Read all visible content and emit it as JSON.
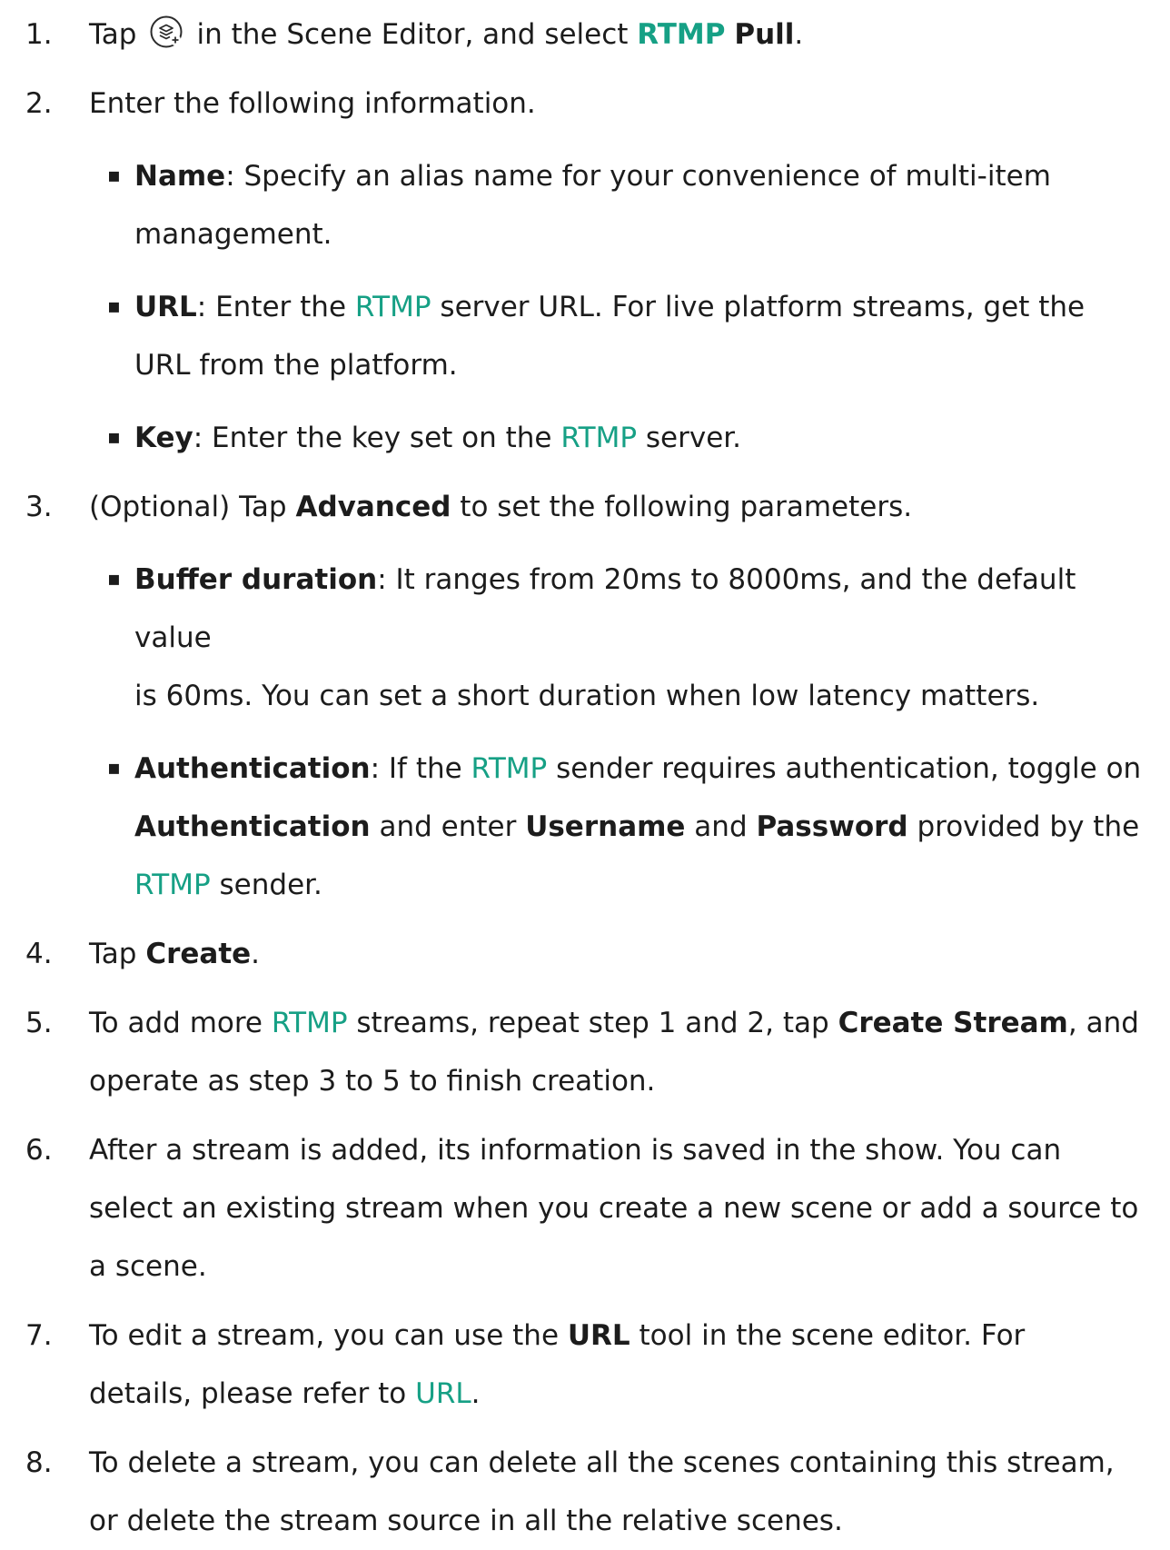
{
  "steps": [
    {
      "num": "1.",
      "parts": {
        "a": "Tap",
        "b": "in the Scene Editor, and select",
        "c": "RTMP",
        "d": "Pull",
        "e": "."
      },
      "icon": "layers-add-icon"
    },
    {
      "num": "2.",
      "text": "Enter the following information.",
      "bullets": [
        {
          "term": "Name",
          "rest": ": Specify an alias name for your convenience of multi-item",
          "cont": "management."
        },
        {
          "term": "URL",
          "pre": ": Enter the ",
          "link": "RTMP",
          "rest": " server URL. For live platform streams, get the",
          "cont": "URL from the platform."
        },
        {
          "term": "Key",
          "pre": ": Enter the key set on the ",
          "link": "RTMP",
          "rest": " server."
        }
      ]
    },
    {
      "num": "3.",
      "pre": "(Optional) Tap ",
      "bold": "Advanced",
      "rest": " to set the following parameters.",
      "bullets": [
        {
          "term": "Buffer duration",
          "rest": ": It ranges from 20ms to 8000ms, and the default value",
          "cont": "is 60ms. You can set a short duration when low latency matters."
        },
        {
          "term": "Authentication",
          "pre": ": If the ",
          "link": "RTMP",
          "rest": " sender requires authentication, toggle on",
          "line2_bold1": "Authentication",
          "line2_a": " and enter ",
          "line2_bold2": "Username",
          "line2_b": " and ",
          "line2_bold3": "Password",
          "line2_c": " provided by the",
          "line3_link": "RTMP",
          "line3_rest": " sender."
        }
      ]
    },
    {
      "num": "4.",
      "pre": "Tap ",
      "bold": "Create",
      "rest": "."
    },
    {
      "num": "5.",
      "pre": "To add more ",
      "link": "RTMP",
      "mid": " streams, repeat step 1 and 2, tap ",
      "bold": "Create Stream",
      "rest": ", and",
      "cont": "operate as step 3 to 5 to finish creation."
    },
    {
      "num": "6.",
      "line1": "After a stream is added, its information is saved in the show. You can",
      "line2": "select an existing stream when you create a new scene or add a source to",
      "line3": "a scene."
    },
    {
      "num": "7.",
      "pre": "To edit a stream, you can use the ",
      "bold": "URL",
      "rest": " tool in the scene editor. For",
      "cont_pre": "details, please refer to ",
      "cont_link": "URL",
      "cont_rest": "."
    },
    {
      "num": "8.",
      "line1": "To delete a stream, you can delete all the scenes containing this stream,",
      "line2": "or delete the stream source in all the relative scenes."
    }
  ],
  "colors": {
    "link": "#16a085",
    "text": "#1c1c1c"
  },
  "bullet_glyph": "▪"
}
